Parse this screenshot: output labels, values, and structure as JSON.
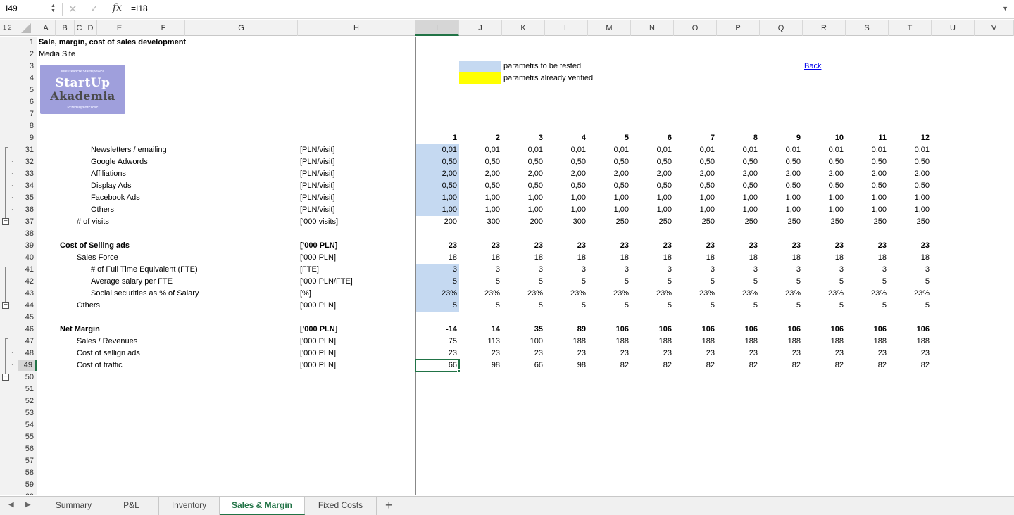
{
  "formula_bar": {
    "name_box": "I49",
    "fx": "fx",
    "formula": "=I18"
  },
  "column_header": {
    "outline_levels": "1 2",
    "columns": [
      {
        "id": "A",
        "label": "A"
      },
      {
        "id": "B",
        "label": "B"
      },
      {
        "id": "C",
        "label": "C"
      },
      {
        "id": "D",
        "label": "D"
      },
      {
        "id": "E",
        "label": "E"
      },
      {
        "id": "F",
        "label": "F"
      },
      {
        "id": "G",
        "label": "G"
      },
      {
        "id": "H",
        "label": "H"
      },
      {
        "id": "I",
        "label": "I"
      },
      {
        "id": "J",
        "label": "J"
      },
      {
        "id": "K",
        "label": "K"
      },
      {
        "id": "L",
        "label": "L"
      },
      {
        "id": "M",
        "label": "M"
      },
      {
        "id": "N",
        "label": "N"
      },
      {
        "id": "O",
        "label": "O"
      },
      {
        "id": "P",
        "label": "P"
      },
      {
        "id": "Q",
        "label": "Q"
      },
      {
        "id": "R",
        "label": "R"
      },
      {
        "id": "S",
        "label": "S"
      },
      {
        "id": "T",
        "label": "T"
      },
      {
        "id": "U",
        "label": "U"
      },
      {
        "id": "V",
        "label": "V"
      }
    ]
  },
  "sheet": {
    "title": "Sale, margin, cost of sales development",
    "subtitle": "Media Site",
    "logo": {
      "top_text": "Mieszkańcik StartUpowca",
      "line1": "StartUp",
      "line2": "Akademia",
      "bottom_text": "Przedsiębiorczość"
    },
    "legend": {
      "tested": "parametrs to be tested",
      "verified": "parametrs already verified",
      "tested_color": "#c5d9f1",
      "verified_color": "#ffff00"
    },
    "back_link": "Back",
    "rows": [
      {
        "n": "1"
      },
      {
        "n": "2"
      },
      {
        "n": "3"
      },
      {
        "n": "4"
      },
      {
        "n": "5"
      },
      {
        "n": "6"
      },
      {
        "n": "7"
      },
      {
        "n": "8"
      },
      {
        "n": "9",
        "months": [
          "1",
          "2",
          "3",
          "4",
          "5",
          "6",
          "7",
          "8",
          "9",
          "10",
          "11",
          "12"
        ]
      },
      {
        "n": "31",
        "label": "Newsletters / emailing",
        "unit": "[PLN/visit]",
        "values": [
          "0,01",
          "0,01",
          "0,01",
          "0,01",
          "0,01",
          "0,01",
          "0,01",
          "0,01",
          "0,01",
          "0,01",
          "0,01",
          "0,01"
        ]
      },
      {
        "n": "32",
        "label": "Google Adwords",
        "unit": "[PLN/visit]",
        "values": [
          "0,50",
          "0,50",
          "0,50",
          "0,50",
          "0,50",
          "0,50",
          "0,50",
          "0,50",
          "0,50",
          "0,50",
          "0,50",
          "0,50"
        ]
      },
      {
        "n": "33",
        "label": "Affiliations",
        "unit": "[PLN/visit]",
        "values": [
          "2,00",
          "2,00",
          "2,00",
          "2,00",
          "2,00",
          "2,00",
          "2,00",
          "2,00",
          "2,00",
          "2,00",
          "2,00",
          "2,00"
        ]
      },
      {
        "n": "34",
        "label": "Display Ads",
        "unit": "[PLN/visit]",
        "values": [
          "0,50",
          "0,50",
          "0,50",
          "0,50",
          "0,50",
          "0,50",
          "0,50",
          "0,50",
          "0,50",
          "0,50",
          "0,50",
          "0,50"
        ]
      },
      {
        "n": "35",
        "label": "Facebook Ads",
        "unit": "[PLN/visit]",
        "values": [
          "1,00",
          "1,00",
          "1,00",
          "1,00",
          "1,00",
          "1,00",
          "1,00",
          "1,00",
          "1,00",
          "1,00",
          "1,00",
          "1,00"
        ]
      },
      {
        "n": "36",
        "label": "Others",
        "unit": "[PLN/visit]",
        "values": [
          "1,00",
          "1,00",
          "1,00",
          "1,00",
          "1,00",
          "1,00",
          "1,00",
          "1,00",
          "1,00",
          "1,00",
          "1,00",
          "1,00"
        ]
      },
      {
        "n": "37",
        "label": "# of visits",
        "unit": "['000 visits]",
        "values": [
          "200",
          "300",
          "200",
          "300",
          "250",
          "250",
          "250",
          "250",
          "250",
          "250",
          "250",
          "250"
        ]
      },
      {
        "n": "38"
      },
      {
        "n": "39",
        "label": "Cost of Selling ads",
        "unit": "['000 PLN]",
        "values": [
          "23",
          "23",
          "23",
          "23",
          "23",
          "23",
          "23",
          "23",
          "23",
          "23",
          "23",
          "23"
        ]
      },
      {
        "n": "40",
        "label": "Sales Force",
        "unit": "['000 PLN]",
        "values": [
          "18",
          "18",
          "18",
          "18",
          "18",
          "18",
          "18",
          "18",
          "18",
          "18",
          "18",
          "18"
        ]
      },
      {
        "n": "41",
        "label": "# of Full Time Equivalent (FTE)",
        "unit": "[FTE]",
        "values": [
          "3",
          "3",
          "3",
          "3",
          "3",
          "3",
          "3",
          "3",
          "3",
          "3",
          "3",
          "3"
        ]
      },
      {
        "n": "42",
        "label": "Average salary per FTE",
        "unit": "['000 PLN/FTE]",
        "values": [
          "5",
          "5",
          "5",
          "5",
          "5",
          "5",
          "5",
          "5",
          "5",
          "5",
          "5",
          "5"
        ]
      },
      {
        "n": "43",
        "label": "Social securities as % of Salary",
        "unit": "[%]",
        "values": [
          "23%",
          "23%",
          "23%",
          "23%",
          "23%",
          "23%",
          "23%",
          "23%",
          "23%",
          "23%",
          "23%",
          "23%"
        ]
      },
      {
        "n": "44",
        "label": "Others",
        "unit": "['000 PLN]",
        "values": [
          "5",
          "5",
          "5",
          "5",
          "5",
          "5",
          "5",
          "5",
          "5",
          "5",
          "5",
          "5"
        ]
      },
      {
        "n": "45"
      },
      {
        "n": "46",
        "label": "Net Margin",
        "unit": "['000 PLN]",
        "values": [
          "-14",
          "14",
          "35",
          "89",
          "106",
          "106",
          "106",
          "106",
          "106",
          "106",
          "106",
          "106"
        ]
      },
      {
        "n": "47",
        "label": "Sales / Revenues",
        "unit": "['000 PLN]",
        "values": [
          "75",
          "113",
          "100",
          "188",
          "188",
          "188",
          "188",
          "188",
          "188",
          "188",
          "188",
          "188"
        ]
      },
      {
        "n": "48",
        "label": "Cost of sellign ads",
        "unit": "['000 PLN]",
        "values": [
          "23",
          "23",
          "23",
          "23",
          "23",
          "23",
          "23",
          "23",
          "23",
          "23",
          "23",
          "23"
        ]
      },
      {
        "n": "49",
        "label": "Cost of traffic",
        "unit": "['000 PLN]",
        "values": [
          "66",
          "98",
          "66",
          "98",
          "82",
          "82",
          "82",
          "82",
          "82",
          "82",
          "82",
          "82"
        ]
      },
      {
        "n": "50"
      },
      {
        "n": "51"
      },
      {
        "n": "52"
      },
      {
        "n": "53"
      },
      {
        "n": "54"
      },
      {
        "n": "55"
      },
      {
        "n": "56"
      },
      {
        "n": "57"
      },
      {
        "n": "58"
      },
      {
        "n": "59"
      },
      {
        "n": "60"
      }
    ]
  },
  "tabs": [
    {
      "label": "Summary",
      "active": false
    },
    {
      "label": "P&L",
      "active": false
    },
    {
      "label": "Inventory",
      "active": false
    },
    {
      "label": "Sales & Margin",
      "active": true
    },
    {
      "label": "Fixed Costs",
      "active": false
    }
  ],
  "tab_add": "+"
}
